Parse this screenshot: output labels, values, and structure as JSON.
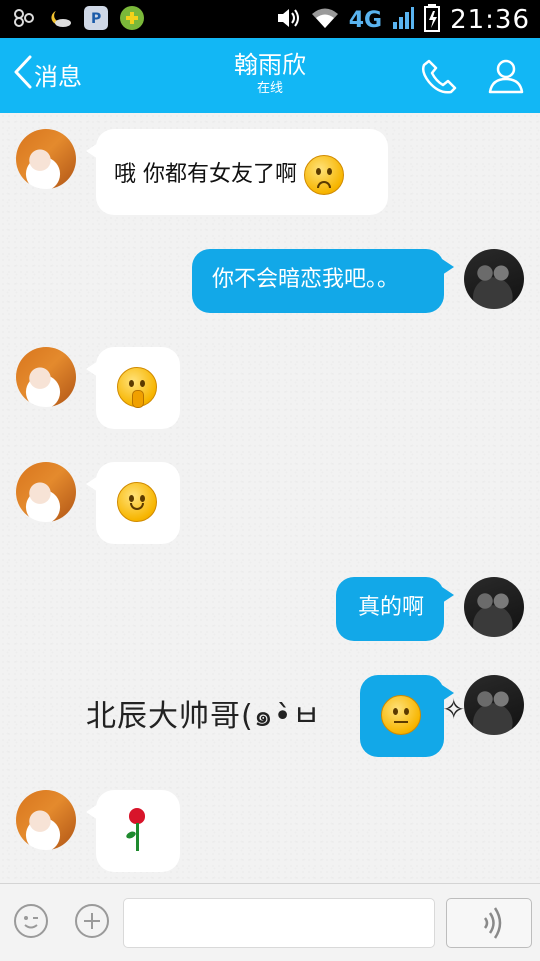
{
  "status_bar": {
    "time": "21:36",
    "network": "4G",
    "left_icons": [
      "app-icon",
      "weather-icon",
      "paypal-icon",
      "game-icon"
    ],
    "right_icons": [
      "volume-icon",
      "wifi-icon",
      "signal-icon",
      "battery-icon"
    ]
  },
  "header": {
    "back_label": "消息",
    "contact_name": "翰雨欣",
    "contact_status": "在线",
    "accent": "#12b7f5"
  },
  "messages": [
    {
      "side": "incoming",
      "text": "哦  你都有女友了啊",
      "emoji": "sad-face-icon"
    },
    {
      "side": "outgoing",
      "text": "你不会暗恋我吧。。"
    },
    {
      "side": "incoming",
      "emoji": "shush-face-icon"
    },
    {
      "side": "incoming",
      "emoji": "smile-face-icon"
    },
    {
      "side": "outgoing",
      "text": "真的啊"
    },
    {
      "side": "outgoing",
      "emoji": "stunned-face-icon"
    },
    {
      "side": "incoming",
      "emoji": "rose-icon"
    }
  ],
  "nickname_line": "北辰大帅哥(๑•̀ㅂ",
  "nickname_sparkle": "✧",
  "input": {
    "value": "",
    "placeholder": ""
  },
  "colors": {
    "outgoing_bubble": "#12a8e8",
    "incoming_bubble": "#ffffff",
    "header_bg": "#12b7f5"
  }
}
